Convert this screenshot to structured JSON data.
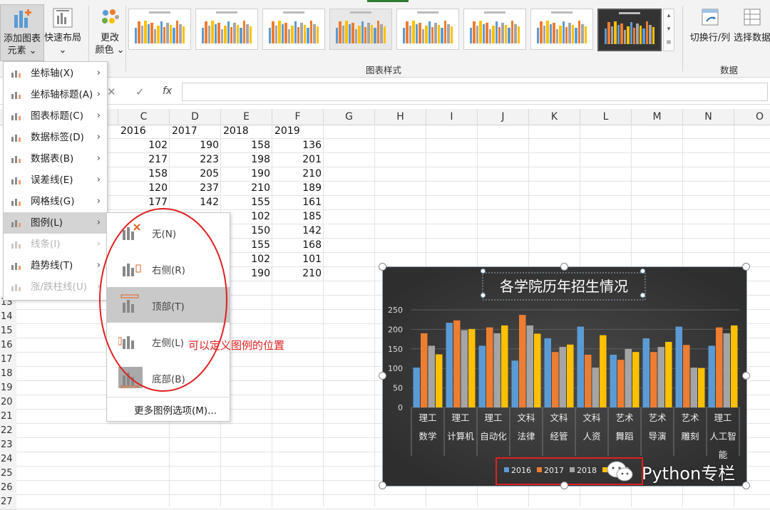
{
  "ribbon": {
    "add_chart_element": "添加图表\n元素",
    "add_chart_element_l1": "添加图表",
    "add_chart_element_l2": "元素 ⌄",
    "quick_layout_l1": "快速布局",
    "quick_layout_l2": "⌄",
    "change_colors_l1": "更改",
    "change_colors_l2": "颜色 ⌄",
    "chart_styles_group": "图表样式",
    "switch_row_col": "切换行/列",
    "select_data": "选择数据",
    "data_group": "数据"
  },
  "formula_bar": {
    "cancel": "✕",
    "confirm": "✓",
    "fx": "fx",
    "value": ""
  },
  "columns": [
    "C",
    "D",
    "E",
    "F",
    "G",
    "H",
    "I",
    "J",
    "K",
    "L",
    "M",
    "N",
    "O"
  ],
  "rows": [
    "13",
    "14",
    "15",
    "16",
    "17",
    "18",
    "19",
    "20",
    "21",
    "22",
    "23",
    "24",
    "25",
    "26",
    "27"
  ],
  "year_headers": [
    "2016",
    "2017",
    "2018",
    "2019"
  ],
  "table_values": [
    [
      "102",
      "190",
      "158",
      "136"
    ],
    [
      "217",
      "223",
      "198",
      "201"
    ],
    [
      "158",
      "205",
      "190",
      "210"
    ],
    [
      "120",
      "237",
      "210",
      "189"
    ],
    [
      "177",
      "142",
      "155",
      "161"
    ],
    [
      "",
      "",
      "102",
      "185"
    ],
    [
      "",
      "",
      "150",
      "142"
    ],
    [
      "",
      "",
      "155",
      "168"
    ],
    [
      "",
      "",
      "102",
      "101"
    ],
    [
      "",
      "",
      "190",
      "210"
    ]
  ],
  "menu": {
    "items": [
      {
        "label": "坐标轴(X)",
        "disabled": false
      },
      {
        "label": "坐标轴标题(A)",
        "disabled": false
      },
      {
        "label": "图表标题(C)",
        "disabled": false
      },
      {
        "label": "数据标签(D)",
        "disabled": false
      },
      {
        "label": "数据表(B)",
        "disabled": false
      },
      {
        "label": "误差线(E)",
        "disabled": false
      },
      {
        "label": "网格线(G)",
        "disabled": false
      },
      {
        "label": "图例(L)",
        "disabled": false
      },
      {
        "label": "线条(I)",
        "disabled": true
      },
      {
        "label": "趋势线(T)",
        "disabled": false
      },
      {
        "label": "涨/跌柱线(U)",
        "disabled": true
      }
    ],
    "arrow": "›"
  },
  "submenu": {
    "items": [
      "无(N)",
      "右侧(R)",
      "顶部(T)",
      "左侧(L)",
      "底部(B)"
    ],
    "more": "更多图例选项(M)..."
  },
  "annotation": "可以定义图例的位置",
  "watermark": "Python专栏",
  "colors": {
    "s2016": "#5b9bd5",
    "s2017": "#ed7d31",
    "s2018": "#a5a5a5",
    "s2019": "#ffc000",
    "annotation": "#e02020"
  },
  "chart_data": {
    "type": "bar",
    "title": "各学院历年招生情况",
    "categories": [
      [
        "理工",
        "数学"
      ],
      [
        "理工",
        "计算机"
      ],
      [
        "理工",
        "自动化"
      ],
      [
        "文科",
        "法律"
      ],
      [
        "文科",
        "经管"
      ],
      [
        "文科",
        "人资"
      ],
      [
        "艺术",
        "舞蹈"
      ],
      [
        "艺术",
        "导演"
      ],
      [
        "艺术",
        "雕刻"
      ],
      [
        "理工",
        "人工智",
        "能"
      ]
    ],
    "series": [
      {
        "name": "2016",
        "values": [
          102,
          217,
          158,
          120,
          177,
          207,
          135,
          177,
          207,
          158
        ]
      },
      {
        "name": "2017",
        "values": [
          190,
          223,
          205,
          237,
          142,
          135,
          122,
          142,
          160,
          205
        ]
      },
      {
        "name": "2018",
        "values": [
          158,
          198,
          190,
          210,
          155,
          102,
          150,
          155,
          102,
          190
        ]
      },
      {
        "name": "2019",
        "values": [
          136,
          201,
          210,
          189,
          161,
          185,
          142,
          168,
          101,
          210
        ]
      }
    ],
    "yticks": [
      0,
      50,
      100,
      150,
      200,
      250
    ],
    "ylim": [
      0,
      250
    ],
    "legend": "bottom",
    "grid": true
  }
}
